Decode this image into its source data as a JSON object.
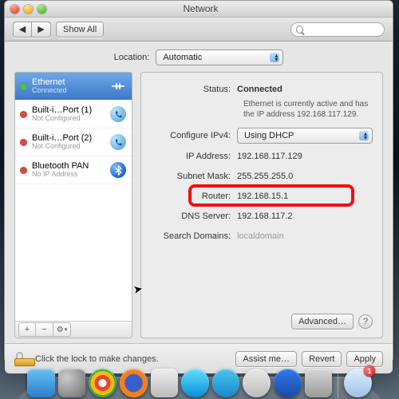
{
  "window": {
    "title": "Network"
  },
  "toolbar": {
    "back_aria": "Back",
    "fwd_aria": "Forward",
    "showall_label": "Show All",
    "search_placeholder": ""
  },
  "location": {
    "label": "Location:",
    "value": "Automatic"
  },
  "sidebar": {
    "items": [
      {
        "name": "Ethernet",
        "sub": "Connected",
        "status": "green",
        "icon": "ethernet"
      },
      {
        "name": "Built-i…Port (1)",
        "sub": "Not Configured",
        "status": "red",
        "icon": "phone"
      },
      {
        "name": "Built-i…Port (2)",
        "sub": "Not Configured",
        "status": "red",
        "icon": "phone"
      },
      {
        "name": "Bluetooth PAN",
        "sub": "No IP Address",
        "status": "red",
        "icon": "bluetooth"
      }
    ],
    "add": "+",
    "remove": "−",
    "gear": "⚙"
  },
  "detail": {
    "status_label": "Status:",
    "status_value": "Connected",
    "status_desc": "Ethernet is currently active and has the IP address 192.168.117.129.",
    "ipv4_label": "Configure IPv4:",
    "ipv4_value": "Using DHCP",
    "ip_label": "IP Address:",
    "ip_value": "192.168.117.129",
    "mask_label": "Subnet Mask:",
    "mask_value": "255.255.255.0",
    "router_label": "Router:",
    "router_value": "192.168.15.1",
    "dns_label": "DNS Server:",
    "dns_value": "192.168.117.2",
    "search_label": "Search Domains:",
    "search_value": "localdomain",
    "advanced_label": "Advanced…",
    "help": "?"
  },
  "footer": {
    "lock_msg": "Click the lock to make changes.",
    "assist": "Assist me…",
    "revert": "Revert",
    "apply": "Apply"
  },
  "dock": {
    "download_badge": "1"
  }
}
